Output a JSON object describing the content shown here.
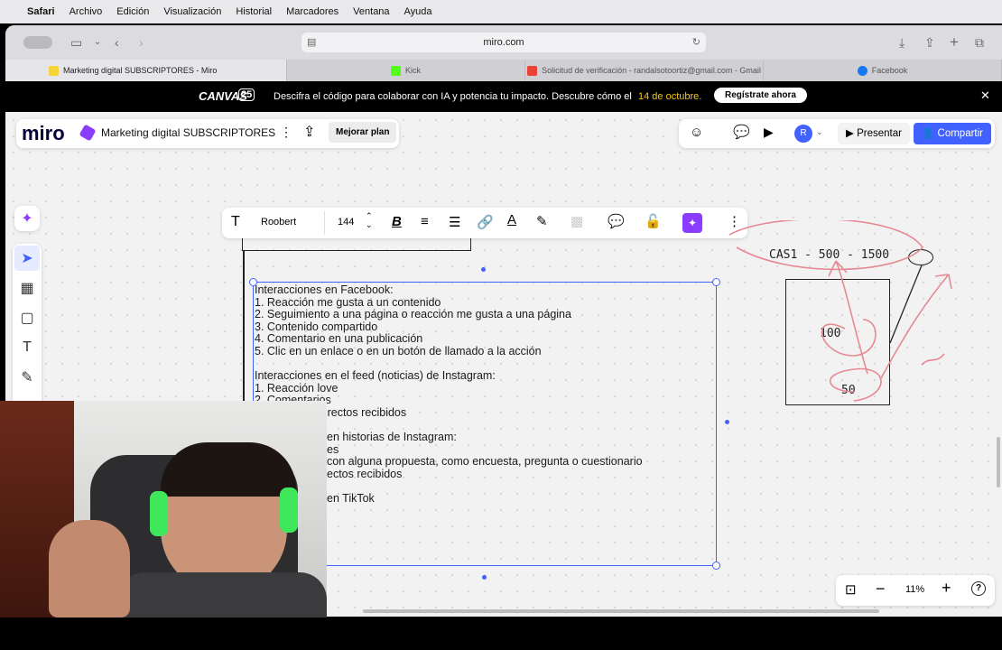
{
  "menubar": {
    "app": "Safari",
    "items": [
      "Archivo",
      "Edición",
      "Visualización",
      "Historial",
      "Marcadores",
      "Ventana",
      "Ayuda"
    ]
  },
  "browser": {
    "url": "miro.com",
    "tabs": [
      {
        "label": "Marketing digital SUBSCRIPTORES - Miro",
        "color": "#f7d33a"
      },
      {
        "label": "Kick",
        "color": "#53fc18"
      },
      {
        "label": "Solicitud de verificación - randalsotoortiz@gmail.com - Gmail",
        "color": "#ea4335"
      },
      {
        "label": "Facebook",
        "color": "#1877f2"
      }
    ]
  },
  "banner": {
    "logo": "CANVAS",
    "logo_num": "25",
    "text": "Descifra el código para colaborar con IA y potencia tu impacto. Descubre cómo el",
    "date": "14 de octubre.",
    "cta": "Regístrate ahora"
  },
  "miro": {
    "logo": "miro",
    "board_title": "Marketing digital SUBSCRIPTORES",
    "upgrade": "Mejorar plan",
    "avatar": "R",
    "present": "Presentar",
    "share": "Compartir"
  },
  "format_toolbar": {
    "font": "Roobert",
    "size": "144"
  },
  "text_block": {
    "lines": [
      "Interacciones en Facebook:",
      "1. Reacción me gusta a un contenido",
      "2. Seguimiento a una página o reacción me gusta a una página",
      "3. Contenido compartido",
      "4. Comentario en una publicación",
      "5. Clic en un enlace o en un botón de llamado a la acción",
      "",
      "Interacciones en el feed (noticias) de Instagram:",
      "1. Reacción love",
      "2. Comentarios",
      "3. Mensajes directos recibidos",
      "",
      "en historias de Instagram:",
      "es",
      "con alguna propuesta, como encuesta, pregunta o cuestionario",
      "ectos recibidos",
      "",
      "en TikTok"
    ]
  },
  "sketch": {
    "title": "CAS1 - 500 - 1500",
    "box_value_top": "100",
    "box_value_bottom": "50"
  },
  "zoom": {
    "level": "11%"
  },
  "colors": {
    "accent": "#4262ff",
    "sketch_red": "#e58a93",
    "banner_date": "#f5c518"
  }
}
